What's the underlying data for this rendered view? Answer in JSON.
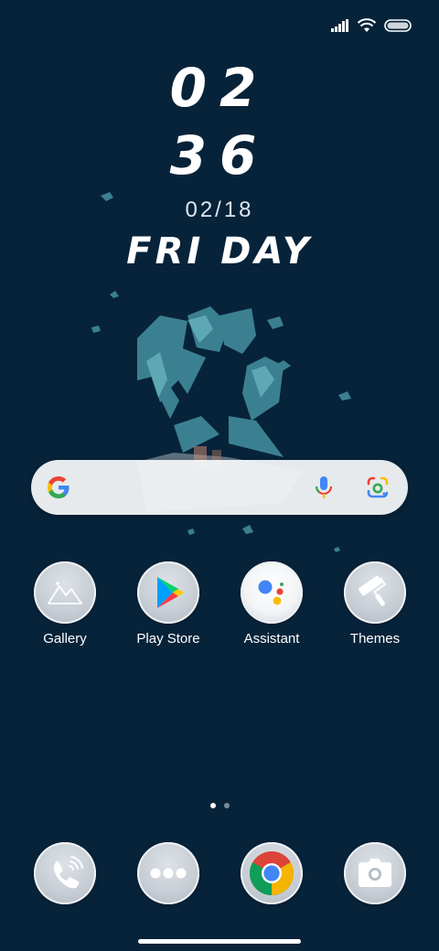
{
  "status_bar": {
    "icons": [
      "signal-icon",
      "wifi-icon",
      "battery-icon"
    ]
  },
  "clock": {
    "hours": "02",
    "minutes": "36",
    "date": "02/18",
    "weekday": "FRI DAY"
  },
  "search": {
    "icons": [
      "google-logo-icon",
      "microphone-icon",
      "google-lens-icon"
    ]
  },
  "apps": [
    {
      "label": "Gallery",
      "icon": "gallery-icon"
    },
    {
      "label": "Play Store",
      "icon": "play-store-icon"
    },
    {
      "label": "Assistant",
      "icon": "assistant-icon"
    },
    {
      "label": "Themes",
      "icon": "themes-icon"
    }
  ],
  "page_indicator": {
    "total": 2,
    "active": 1
  },
  "dock": [
    {
      "icon": "phone-icon"
    },
    {
      "icon": "more-apps-icon"
    },
    {
      "icon": "chrome-icon"
    },
    {
      "icon": "camera-icon"
    }
  ],
  "colors": {
    "background": "#07233a",
    "wallpaper_accent": "#4fa3b2",
    "icon_circle": "#c9d0d7"
  }
}
